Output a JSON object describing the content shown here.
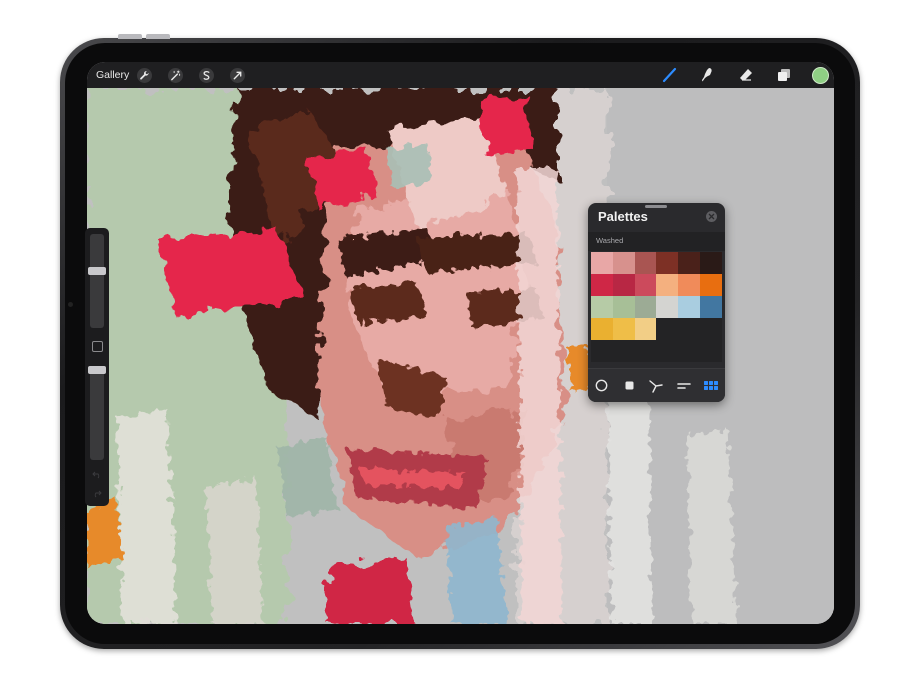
{
  "toolbar": {
    "gallery_label": "Gallery",
    "left_tools": [
      "wrench-icon",
      "magic-wand-icon",
      "selection-icon",
      "transform-icon"
    ],
    "right_tools": [
      "brush-icon",
      "smudge-icon",
      "eraser-icon",
      "layers-icon"
    ],
    "active_tool": "brush-icon",
    "active_color": "#8fcf84",
    "accent_color": "#2d8cff"
  },
  "sidebar": {
    "brush_size": 0.2,
    "opacity": 0.15
  },
  "palettes": {
    "title": "Palettes",
    "palette_name": "Washed",
    "colors": [
      "#e8a7a6",
      "#d7918d",
      "#a95552",
      "#7d3025",
      "#4a211a",
      "#2a1a17",
      "#cf2746",
      "#b82744",
      "#cc4a5c",
      "#f4b07f",
      "#f08b5a",
      "#e86e10",
      "#b6cba6",
      "#a7bf97",
      "#9cab95",
      "#d4d4d1",
      "#a9cde0",
      "#4277a1",
      "#eab030",
      "#efbe48",
      "#f2ce86"
    ],
    "empty_cells": 9,
    "footer_tools": [
      "disc-icon",
      "square-icon",
      "harmony-icon",
      "value-icon",
      "palettes-grid-icon"
    ],
    "active_footer_tool": "palettes-grid-icon"
  }
}
